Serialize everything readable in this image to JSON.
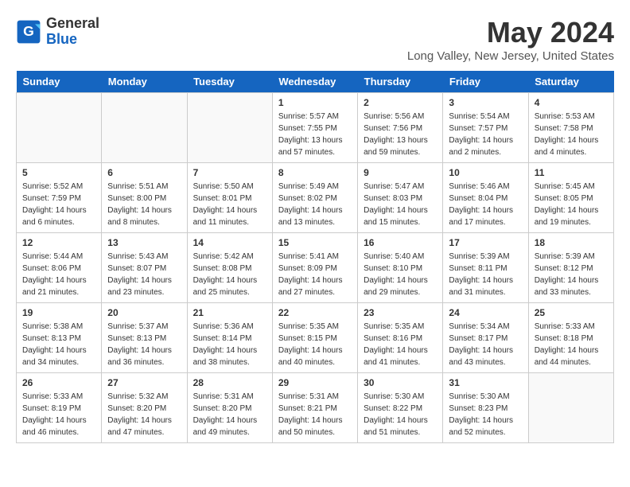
{
  "header": {
    "logo_line1": "General",
    "logo_line2": "Blue",
    "month": "May 2024",
    "location": "Long Valley, New Jersey, United States"
  },
  "days_of_week": [
    "Sunday",
    "Monday",
    "Tuesday",
    "Wednesday",
    "Thursday",
    "Friday",
    "Saturday"
  ],
  "weeks": [
    [
      {
        "day": "",
        "empty": true
      },
      {
        "day": "",
        "empty": true
      },
      {
        "day": "",
        "empty": true
      },
      {
        "day": "1",
        "sunrise": "Sunrise: 5:57 AM",
        "sunset": "Sunset: 7:55 PM",
        "daylight": "Daylight: 13 hours and 57 minutes."
      },
      {
        "day": "2",
        "sunrise": "Sunrise: 5:56 AM",
        "sunset": "Sunset: 7:56 PM",
        "daylight": "Daylight: 13 hours and 59 minutes."
      },
      {
        "day": "3",
        "sunrise": "Sunrise: 5:54 AM",
        "sunset": "Sunset: 7:57 PM",
        "daylight": "Daylight: 14 hours and 2 minutes."
      },
      {
        "day": "4",
        "sunrise": "Sunrise: 5:53 AM",
        "sunset": "Sunset: 7:58 PM",
        "daylight": "Daylight: 14 hours and 4 minutes."
      }
    ],
    [
      {
        "day": "5",
        "sunrise": "Sunrise: 5:52 AM",
        "sunset": "Sunset: 7:59 PM",
        "daylight": "Daylight: 14 hours and 6 minutes."
      },
      {
        "day": "6",
        "sunrise": "Sunrise: 5:51 AM",
        "sunset": "Sunset: 8:00 PM",
        "daylight": "Daylight: 14 hours and 8 minutes."
      },
      {
        "day": "7",
        "sunrise": "Sunrise: 5:50 AM",
        "sunset": "Sunset: 8:01 PM",
        "daylight": "Daylight: 14 hours and 11 minutes."
      },
      {
        "day": "8",
        "sunrise": "Sunrise: 5:49 AM",
        "sunset": "Sunset: 8:02 PM",
        "daylight": "Daylight: 14 hours and 13 minutes."
      },
      {
        "day": "9",
        "sunrise": "Sunrise: 5:47 AM",
        "sunset": "Sunset: 8:03 PM",
        "daylight": "Daylight: 14 hours and 15 minutes."
      },
      {
        "day": "10",
        "sunrise": "Sunrise: 5:46 AM",
        "sunset": "Sunset: 8:04 PM",
        "daylight": "Daylight: 14 hours and 17 minutes."
      },
      {
        "day": "11",
        "sunrise": "Sunrise: 5:45 AM",
        "sunset": "Sunset: 8:05 PM",
        "daylight": "Daylight: 14 hours and 19 minutes."
      }
    ],
    [
      {
        "day": "12",
        "sunrise": "Sunrise: 5:44 AM",
        "sunset": "Sunset: 8:06 PM",
        "daylight": "Daylight: 14 hours and 21 minutes."
      },
      {
        "day": "13",
        "sunrise": "Sunrise: 5:43 AM",
        "sunset": "Sunset: 8:07 PM",
        "daylight": "Daylight: 14 hours and 23 minutes."
      },
      {
        "day": "14",
        "sunrise": "Sunrise: 5:42 AM",
        "sunset": "Sunset: 8:08 PM",
        "daylight": "Daylight: 14 hours and 25 minutes."
      },
      {
        "day": "15",
        "sunrise": "Sunrise: 5:41 AM",
        "sunset": "Sunset: 8:09 PM",
        "daylight": "Daylight: 14 hours and 27 minutes."
      },
      {
        "day": "16",
        "sunrise": "Sunrise: 5:40 AM",
        "sunset": "Sunset: 8:10 PM",
        "daylight": "Daylight: 14 hours and 29 minutes."
      },
      {
        "day": "17",
        "sunrise": "Sunrise: 5:39 AM",
        "sunset": "Sunset: 8:11 PM",
        "daylight": "Daylight: 14 hours and 31 minutes."
      },
      {
        "day": "18",
        "sunrise": "Sunrise: 5:39 AM",
        "sunset": "Sunset: 8:12 PM",
        "daylight": "Daylight: 14 hours and 33 minutes."
      }
    ],
    [
      {
        "day": "19",
        "sunrise": "Sunrise: 5:38 AM",
        "sunset": "Sunset: 8:13 PM",
        "daylight": "Daylight: 14 hours and 34 minutes."
      },
      {
        "day": "20",
        "sunrise": "Sunrise: 5:37 AM",
        "sunset": "Sunset: 8:13 PM",
        "daylight": "Daylight: 14 hours and 36 minutes."
      },
      {
        "day": "21",
        "sunrise": "Sunrise: 5:36 AM",
        "sunset": "Sunset: 8:14 PM",
        "daylight": "Daylight: 14 hours and 38 minutes."
      },
      {
        "day": "22",
        "sunrise": "Sunrise: 5:35 AM",
        "sunset": "Sunset: 8:15 PM",
        "daylight": "Daylight: 14 hours and 40 minutes."
      },
      {
        "day": "23",
        "sunrise": "Sunrise: 5:35 AM",
        "sunset": "Sunset: 8:16 PM",
        "daylight": "Daylight: 14 hours and 41 minutes."
      },
      {
        "day": "24",
        "sunrise": "Sunrise: 5:34 AM",
        "sunset": "Sunset: 8:17 PM",
        "daylight": "Daylight: 14 hours and 43 minutes."
      },
      {
        "day": "25",
        "sunrise": "Sunrise: 5:33 AM",
        "sunset": "Sunset: 8:18 PM",
        "daylight": "Daylight: 14 hours and 44 minutes."
      }
    ],
    [
      {
        "day": "26",
        "sunrise": "Sunrise: 5:33 AM",
        "sunset": "Sunset: 8:19 PM",
        "daylight": "Daylight: 14 hours and 46 minutes."
      },
      {
        "day": "27",
        "sunrise": "Sunrise: 5:32 AM",
        "sunset": "Sunset: 8:20 PM",
        "daylight": "Daylight: 14 hours and 47 minutes."
      },
      {
        "day": "28",
        "sunrise": "Sunrise: 5:31 AM",
        "sunset": "Sunset: 8:20 PM",
        "daylight": "Daylight: 14 hours and 49 minutes."
      },
      {
        "day": "29",
        "sunrise": "Sunrise: 5:31 AM",
        "sunset": "Sunset: 8:21 PM",
        "daylight": "Daylight: 14 hours and 50 minutes."
      },
      {
        "day": "30",
        "sunrise": "Sunrise: 5:30 AM",
        "sunset": "Sunset: 8:22 PM",
        "daylight": "Daylight: 14 hours and 51 minutes."
      },
      {
        "day": "31",
        "sunrise": "Sunrise: 5:30 AM",
        "sunset": "Sunset: 8:23 PM",
        "daylight": "Daylight: 14 hours and 52 minutes."
      },
      {
        "day": "",
        "empty": true
      }
    ]
  ]
}
